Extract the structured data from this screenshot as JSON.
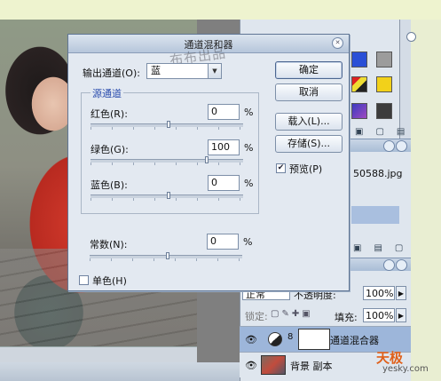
{
  "watermark": "布布出品",
  "dialog": {
    "title": "通道混和器",
    "output_channel_label": "输出通道(O):",
    "output_channel_value": "蓝",
    "source_group_title": "源通道",
    "red_label": "红色(R):",
    "red_value": "0",
    "green_label": "绿色(G):",
    "green_value": "100",
    "blue_label": "蓝色(B):",
    "blue_value": "0",
    "constant_label": "常数(N):",
    "constant_value": "0",
    "percent": "%",
    "monochrome_label": "单色(H)",
    "monochrome_checked": false,
    "preview_label": "预览(P)",
    "preview_checked": true,
    "ok_label": "确定",
    "cancel_label": "取消",
    "load_label": "载入(L)...",
    "save_label": "存储(S)...",
    "slider_levels": {
      "red": 0.5,
      "green": 0.75,
      "blue": 0.5,
      "constant": 0.5
    }
  },
  "panels": {
    "filename": "50588.jpg",
    "layers": {
      "blend_mode": "正常",
      "opacity_label": "不透明度:",
      "opacity_value": "100%",
      "lock_label": "锁定:",
      "fill_label": "填充:",
      "fill_value": "100%",
      "items": [
        {
          "name": "通道混合器",
          "visible": true,
          "selected": true
        },
        {
          "name": "背景 副本",
          "visible": true,
          "selected": false
        }
      ]
    }
  },
  "brand": {
    "name": "天极",
    "url_text": "yesky.com"
  },
  "colors": {
    "dialog_bg": "#e3e9f1",
    "group_title": "#2a4cad",
    "selected_layer": "#9db6da"
  }
}
